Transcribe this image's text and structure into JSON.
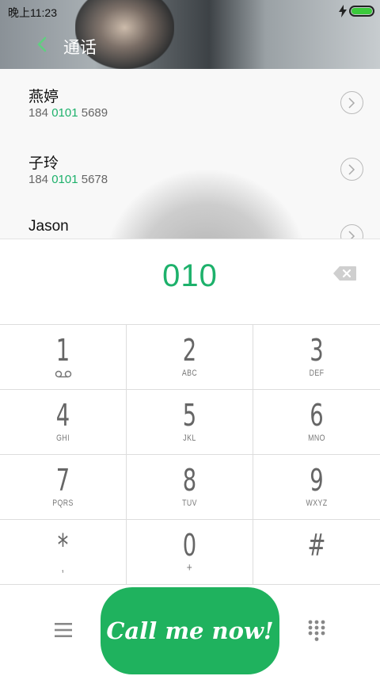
{
  "status": {
    "time": "晚上11:23"
  },
  "header": {
    "title": "通话"
  },
  "contacts": [
    {
      "name": "燕婷",
      "num_pre": "184 ",
      "num_hl": "0101",
      "num_post": " 5689"
    },
    {
      "name": "子玲",
      "num_pre": "184 ",
      "num_hl": "0101",
      "num_post": " 5678"
    },
    {
      "name": "Jason",
      "num_pre": "",
      "num_hl": "",
      "num_post": ""
    }
  ],
  "dialer": {
    "input": "010"
  },
  "keys": [
    {
      "digit": "1",
      "sub": ""
    },
    {
      "digit": "2",
      "sub": "ABC"
    },
    {
      "digit": "3",
      "sub": "DEF"
    },
    {
      "digit": "4",
      "sub": "GHI"
    },
    {
      "digit": "5",
      "sub": "JKL"
    },
    {
      "digit": "6",
      "sub": "MNO"
    },
    {
      "digit": "7",
      "sub": "PQRS"
    },
    {
      "digit": "8",
      "sub": "TUV"
    },
    {
      "digit": "9",
      "sub": "WXYZ"
    },
    {
      "digit": "*",
      "sub": ","
    },
    {
      "digit": "0",
      "sub": "+"
    },
    {
      "digit": "#",
      "sub": ""
    }
  ],
  "call_button": {
    "label": "Call me now!"
  },
  "colors": {
    "accent": "#1db16b",
    "call": "#1fb25e",
    "battery": "#3bc93b"
  }
}
